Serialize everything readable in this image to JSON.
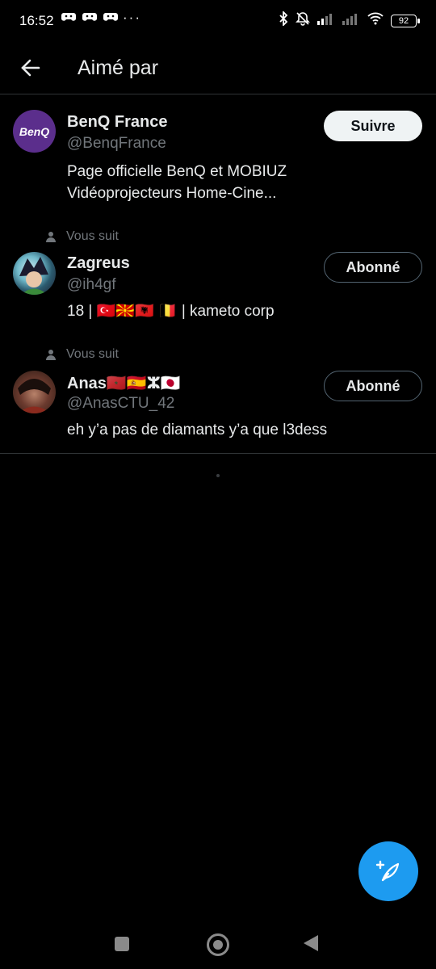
{
  "status_bar": {
    "time": "16:52",
    "more": "···",
    "battery": "92"
  },
  "header": {
    "title": "Aimé par"
  },
  "users": [
    {
      "name": "BenQ France",
      "handle": "@BenqFrance",
      "bio": "Page officielle BenQ et MOBIUZ Vidéoprojecteurs Home-Cine...",
      "avatar_text": "BenQ",
      "button": "Suivre",
      "follows_you": ""
    },
    {
      "name": "Zagreus",
      "handle": "@ih4gf",
      "bio": "18 | 🇹🇷🇲🇰🇦🇱 🇧🇪 | kameto corp",
      "button": "Abonné",
      "follows_you": "Vous suit"
    },
    {
      "name": "Anas🇲🇦🇪🇸ⵣ🇯🇵",
      "handle": "@AnasCTU_42",
      "bio": "eh y’a pas de diamants y’a que l3dess",
      "button": "Abonné",
      "follows_you": "Vous suit"
    }
  ],
  "colors": {
    "accent": "#1d9bf0",
    "background": "#000000",
    "secondary_text": "#71767b",
    "benq_purple": "#5b2e8c"
  },
  "icons": {
    "back": "arrow-left-icon",
    "fab": "compose-tweet-icon",
    "follows": "person-icon"
  }
}
